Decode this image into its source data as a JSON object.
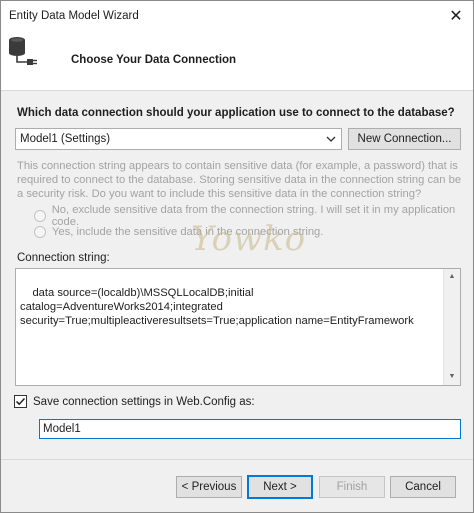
{
  "window": {
    "title": "Entity Data Model Wizard",
    "close_glyph": "✕"
  },
  "header": {
    "title": "Choose Your Data Connection",
    "icon": "database-plug-icon"
  },
  "question": "Which data connection should your application use to connect to the database?",
  "connection_select": {
    "selected": "Model1 (Settings)"
  },
  "new_connection_label": "New Connection...",
  "warning_text": "This connection string appears to contain sensitive data (for example, a password) that is required to connect to the database. Storing sensitive data in the connection string can be a security risk. Do you want to include this sensitive data in the connection string?",
  "radio_options": [
    {
      "label": "No, exclude sensitive data from the connection string. I will set it in my application code.",
      "checked": false,
      "enabled": false
    },
    {
      "label": "Yes, include the sensitive data in the connection string.",
      "checked": false,
      "enabled": false
    }
  ],
  "connection_string_label": "Connection string:",
  "connection_string": "data source=(localdb)\\MSSQLLocalDB;initial catalog=AdventureWorks2014;integrated security=True;multipleactiveresultsets=True;application name=EntityFramework",
  "save_settings": {
    "label": "Save connection settings in Web.Config as:",
    "checked": true,
    "value": "Model1"
  },
  "buttons": {
    "previous": "< Previous",
    "next": "Next >",
    "finish": "Finish",
    "cancel": "Cancel"
  },
  "watermark": "Yowko",
  "colors": {
    "accent": "#0078d7",
    "disabled_text": "#a3a3a3",
    "dialog_bg": "#f0f0f0"
  }
}
